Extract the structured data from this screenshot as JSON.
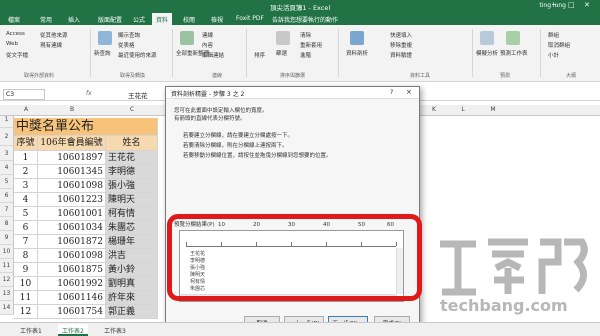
{
  "app": {
    "title": "頂尖活頁簿1 - Excel",
    "user": "ting lung"
  },
  "tabs": [
    "檔案",
    "常用",
    "插入",
    "版面配置",
    "公式",
    "資料",
    "校閱",
    "檢視",
    "Foxit PDF",
    "告訴我您想要執行的動作"
  ],
  "ribbon": {
    "get_external": [
      "Access",
      "Web",
      "從文字檔",
      "從其他來源",
      "現有連線"
    ],
    "get_external_label": "取得外部資料",
    "transform": [
      "新查詢",
      "顯示查詢",
      "從表格",
      "最近使用的來源"
    ],
    "transform_label": "取得及轉換",
    "connections": [
      "全部重新整理",
      "連線",
      "內容",
      "編輯連結"
    ],
    "connections_label": "連線",
    "sort_filter": [
      "排序",
      "篩選",
      "清除",
      "重新套用",
      "進階"
    ],
    "sort_filter_label": "排序與篩選",
    "data_tools": [
      "資料剖析",
      "快速填入",
      "移除重複",
      "資料驗證"
    ],
    "data_tools_label": "資料工具",
    "forecast": [
      "模擬分析",
      "預測工作表"
    ],
    "forecast_label": "預測",
    "outline": [
      "群組",
      "取消群組",
      "小計"
    ],
    "outline_label": "大綱"
  },
  "formula_bar": {
    "name_box": "C3",
    "fx": "fx",
    "value": "王花花"
  },
  "columns": [
    "A",
    "B",
    "C",
    "D",
    "E",
    "F",
    "G",
    "H",
    "I",
    "J",
    "K",
    "L",
    "M"
  ],
  "sheet": {
    "title": "中獎名單公布",
    "headers": [
      "序號",
      "106年會員編號",
      "姓名"
    ],
    "rows": [
      [
        "1",
        "10601897",
        "王花花"
      ],
      [
        "2",
        "10601345",
        "李明德"
      ],
      [
        "3",
        "10601098",
        "張小強"
      ],
      [
        "4",
        "10601223",
        "陳明天"
      ],
      [
        "5",
        "10601001",
        "柯有情"
      ],
      [
        "6",
        "10601034",
        "朱團芯"
      ],
      [
        "7",
        "10601872",
        "楊珊年"
      ],
      [
        "8",
        "10601098",
        "洪吉"
      ],
      [
        "9",
        "10601875",
        "黃小鈴"
      ],
      [
        "10",
        "10601992",
        "劉明真"
      ],
      [
        "11",
        "10601146",
        "許年來"
      ],
      [
        "12",
        "10601754",
        "郭正義"
      ]
    ]
  },
  "row_numbers": [
    "1",
    "2",
    "3",
    "4",
    "5",
    "6",
    "7",
    "8",
    "9",
    "10",
    "11",
    "12",
    "13",
    "14"
  ],
  "sheet_tabs": [
    "工作表1",
    "工作表2",
    "工作表3"
  ],
  "dialog": {
    "title": "資料剖析精靈 - 步驟 3 之 2",
    "help": "?",
    "close": "×",
    "intro": [
      "您可在此畫面中設定輸入欄位的寬度。",
      "有箭頭的直線代表分欄符號。"
    ],
    "instructions": [
      "若要建立分欄線，請在要建立分欄處按一下。",
      "若要清除分欄線，則在分欄線上連按兩下。",
      "若要移動分欄線位置，請按住並拖曳分欄線到您想要的位置。"
    ],
    "preview_label": "預覽分欄結果(P)",
    "ruler": [
      "10",
      "20",
      "30",
      "40",
      "50",
      "60"
    ],
    "preview_lines": [
      "王花花",
      "李明德",
      "張小強",
      "陳明天",
      "柯有情",
      "朱團芯"
    ],
    "buttons": {
      "cancel": "取消",
      "back": "< 上一步(B)",
      "next": "下一步(N) >",
      "finish": "完成(F)"
    }
  },
  "watermark": {
    "text": "techbang.com"
  },
  "colors": {
    "excel_green": "#217346",
    "highlight_red": "#e01a1a",
    "title_fill": "#f7c27a",
    "header_fill": "#f7d9b0"
  }
}
